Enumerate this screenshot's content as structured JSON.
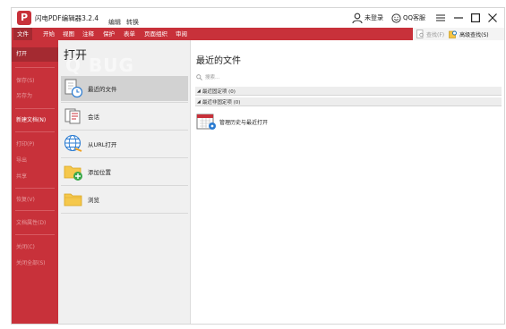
{
  "app": {
    "logo_letter": "P",
    "title": "闪电PDF编辑器3.2.4",
    "menus": [
      "编辑",
      "转换"
    ]
  },
  "account": {
    "login": "未登录",
    "service": "QQ客服"
  },
  "ribbon": {
    "tabs": [
      "文件",
      "开始",
      "视图",
      "注释",
      "保护",
      "表单",
      "页面组织",
      "审阅"
    ],
    "find": "查找(F)",
    "advanced_find": "高级查找(S)"
  },
  "left_menu": [
    {
      "label": "打开",
      "state": "active"
    },
    {
      "label": "保存(S)",
      "state": "disabled"
    },
    {
      "label": "另存为",
      "state": "disabled"
    },
    {
      "label": "新建文档(N)",
      "state": "enabled"
    },
    {
      "label": "打印(P)",
      "state": "disabled"
    },
    {
      "label": "导出",
      "state": "disabled"
    },
    {
      "label": "共享",
      "state": "disabled"
    },
    {
      "label": "恢复(V)",
      "state": "disabled"
    },
    {
      "label": "文档属性(D)",
      "state": "disabled"
    },
    {
      "label": "关闭(C)",
      "state": "disabled"
    },
    {
      "label": "关闭全部(S)",
      "state": "disabled"
    }
  ],
  "open_panel": {
    "title": "打开",
    "items": [
      {
        "label": "最近的文件",
        "icon": "recent-files-icon"
      },
      {
        "label": "会话",
        "icon": "session-icon"
      },
      {
        "label": "从URL打开",
        "icon": "globe-icon"
      },
      {
        "label": "添加位置",
        "icon": "add-folder-icon"
      },
      {
        "label": "浏览",
        "icon": "folder-icon"
      }
    ]
  },
  "recent": {
    "title": "最近的文件",
    "search_placeholder": "搜索...",
    "groups": [
      "最近固定项 (0)",
      "最近非固定项 (0)"
    ],
    "manage": "管理历史与最近打开"
  },
  "watermark": "Q BUG",
  "colors": {
    "accent": "#c8313a",
    "accent_dark": "#a42a31"
  }
}
